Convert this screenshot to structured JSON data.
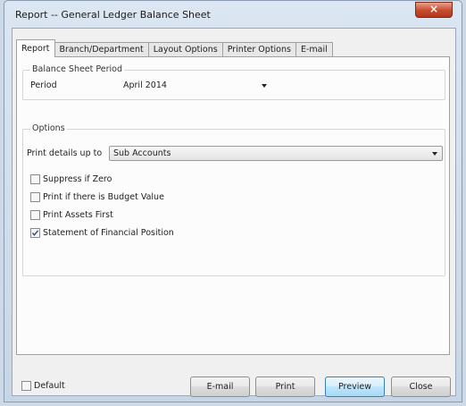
{
  "window": {
    "title": "Report -- General Ledger Balance Sheet",
    "close_symbol": "×"
  },
  "tabs": [
    {
      "label": "Report",
      "active": true
    },
    {
      "label": "Branch/Department",
      "active": false
    },
    {
      "label": "Layout Options",
      "active": false
    },
    {
      "label": "Printer Options",
      "active": false
    },
    {
      "label": "E-mail",
      "active": false
    }
  ],
  "balance_sheet_period": {
    "group_title": "Balance Sheet Period",
    "period_label": "Period",
    "period_value": "April 2014"
  },
  "options": {
    "group_title": "Options",
    "print_details_label": "Print details up to",
    "print_details_value": "Sub Accounts",
    "checkboxes": [
      {
        "label": "Suppress if Zero",
        "checked": false
      },
      {
        "label": "Print if there is Budget Value",
        "checked": false
      },
      {
        "label": "Print Assets First",
        "checked": false
      },
      {
        "label": "Statement of Financial Position",
        "checked": true
      }
    ]
  },
  "footer": {
    "default_label": "Default",
    "default_checked": false,
    "email_button": "E-mail",
    "print_button": "Print",
    "preview_button": "Preview",
    "close_button": "Close"
  },
  "colors": {
    "title_bar": "#cdd9e6",
    "close_button": "#c74a2d",
    "default_button_accent": "#3c7fb1"
  }
}
